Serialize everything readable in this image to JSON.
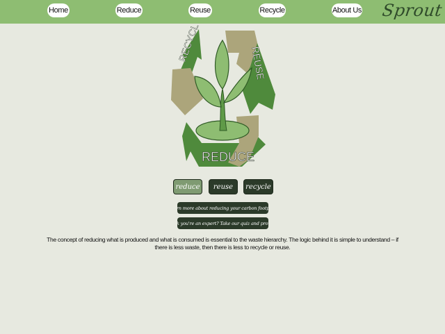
{
  "nav": {
    "items": [
      {
        "label": "Home"
      },
      {
        "label": "Reduce"
      },
      {
        "label": "Reuse"
      },
      {
        "label": "Recycle"
      },
      {
        "label": "About Us"
      }
    ],
    "brand": "Sprout"
  },
  "logo": {
    "arrow_left": "RECYCLE",
    "arrow_right": "REUSE",
    "arrow_bottom": "REDUCE"
  },
  "tabs": [
    {
      "label": "reduce",
      "active": true
    },
    {
      "label": "reuse",
      "active": false
    },
    {
      "label": "recycle",
      "active": false
    }
  ],
  "links": {
    "footprint": "Learn more about reducing your carbon footprint",
    "quiz": "Think you're an expert? Take our quiz and prove it!"
  },
  "content": {
    "description": "The concept of reducing what is produced and what is consumed is essential to the waste hierarchy. The logic behind it is simple to understand – if there is less waste, then there is less to recycle or reuse."
  },
  "colors": {
    "nav_bg": "#8ebd72",
    "page_bg": "#e7e9e0",
    "arrow_dark": "#4f8a3c",
    "arrow_tan": "#aca57b",
    "plant": "#8ebd72",
    "tab_active": "#7f9b72",
    "tab_dark": "#2b3a29"
  }
}
